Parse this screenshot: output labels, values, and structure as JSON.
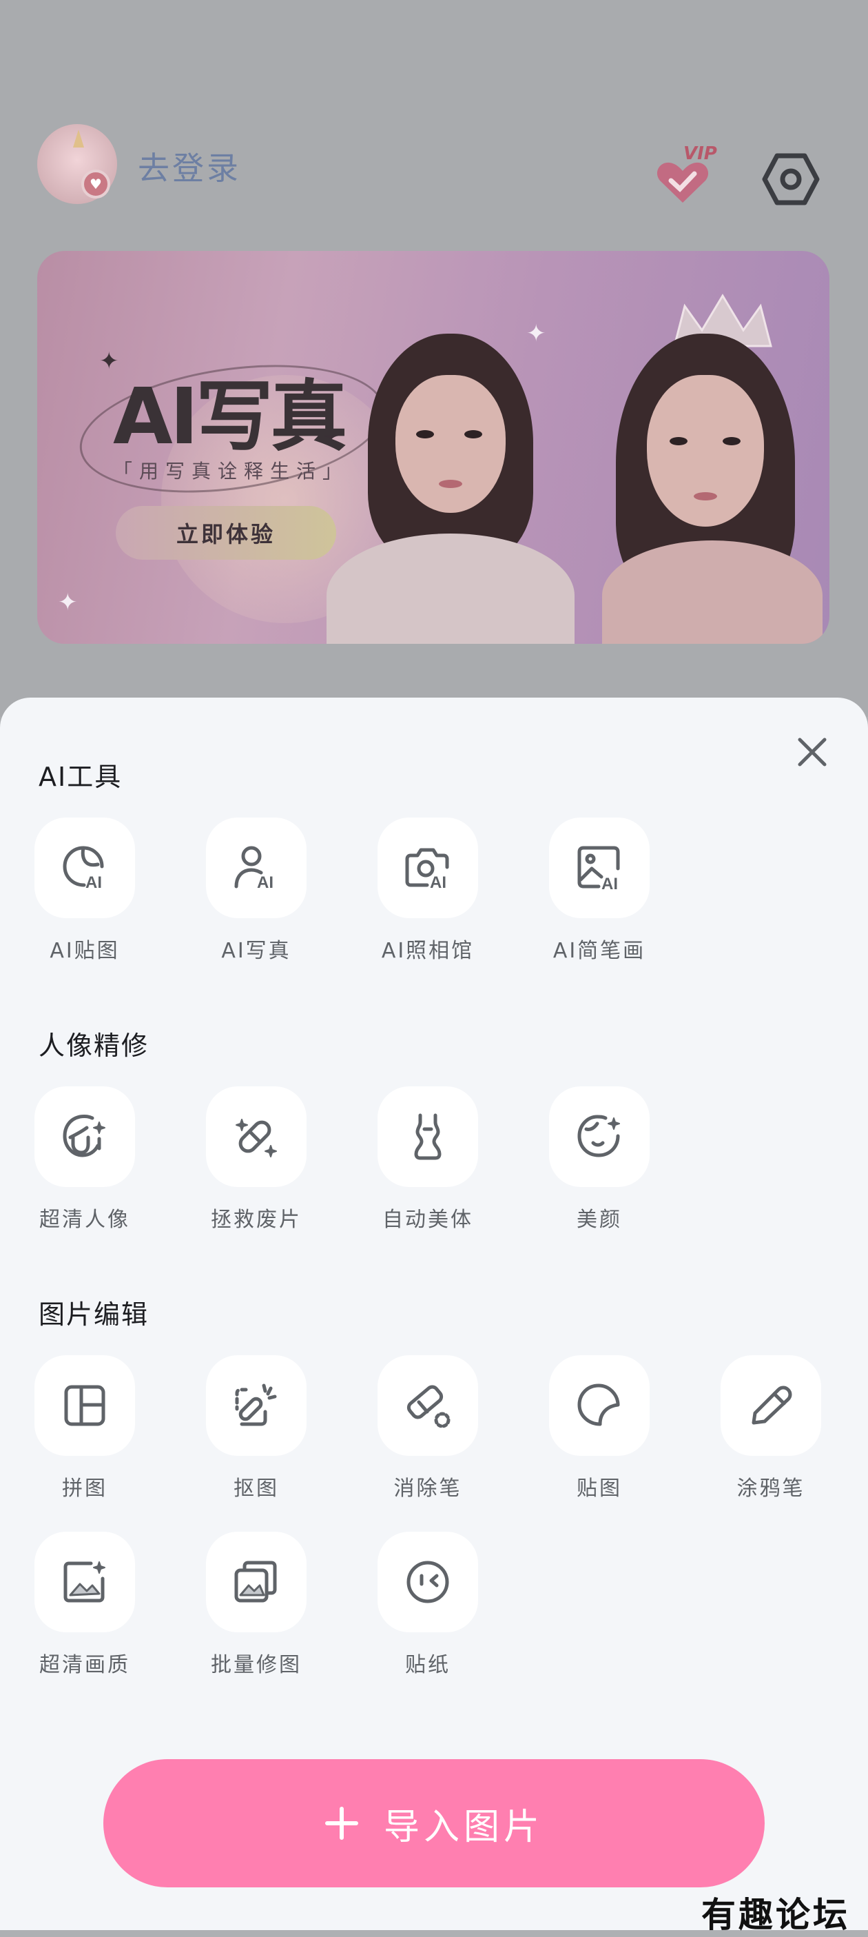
{
  "header": {
    "login_text": "去登录",
    "vip_label": "VIP"
  },
  "banner": {
    "title": "AI写真",
    "subtitle": "「用写真诠释生活」",
    "cta_label": "立即体验"
  },
  "sections": [
    {
      "title": "AI工具",
      "items": [
        {
          "label": "AI贴图",
          "icon": "sticker-ai-icon"
        },
        {
          "label": "AI写真",
          "icon": "portrait-ai-icon"
        },
        {
          "label": "AI照相馆",
          "icon": "camera-ai-icon"
        },
        {
          "label": "AI简笔画",
          "icon": "image-ai-icon"
        }
      ]
    },
    {
      "title": "人像精修",
      "items": [
        {
          "label": "超清人像",
          "icon": "hd-portrait-icon"
        },
        {
          "label": "拯救废片",
          "icon": "bandage-icon"
        },
        {
          "label": "自动美体",
          "icon": "body-shape-icon"
        },
        {
          "label": "美颜",
          "icon": "beauty-face-icon"
        }
      ]
    },
    {
      "title": "图片编辑",
      "items": [
        {
          "label": "拼图",
          "icon": "collage-icon"
        },
        {
          "label": "抠图",
          "icon": "cutout-icon"
        },
        {
          "label": "消除笔",
          "icon": "eraser-icon"
        },
        {
          "label": "贴图",
          "icon": "sticker-icon"
        },
        {
          "label": "涂鸦笔",
          "icon": "pencil-icon"
        },
        {
          "label": "超清画质",
          "icon": "hd-image-icon"
        },
        {
          "label": "批量修图",
          "icon": "batch-edit-icon"
        },
        {
          "label": "贴纸",
          "icon": "emoji-sticker-icon"
        }
      ]
    }
  ],
  "import_button": {
    "label": "导入图片"
  },
  "watermark": "有趣论坛",
  "colors": {
    "accent": "#ff7fb0",
    "sheet_background": "#f4f6f9",
    "tile_background": "#ffffff",
    "icon_stroke": "#5f6368"
  }
}
